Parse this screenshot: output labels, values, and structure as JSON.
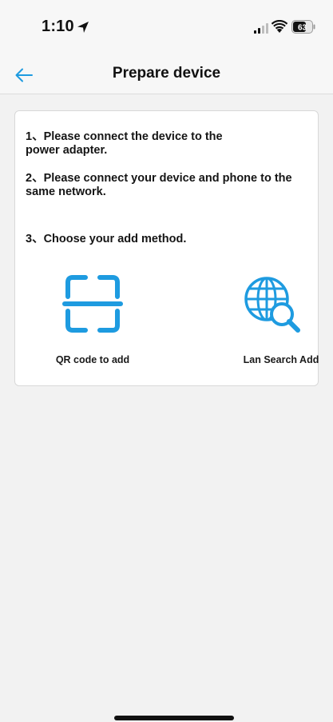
{
  "status_bar": {
    "time": "1:10",
    "battery": "63"
  },
  "nav": {
    "title": "Prepare device"
  },
  "steps": {
    "step1": "1、Please connect the device to the\npower adapter.",
    "step2": "2、Please connect your device and phone to the\nsame network.",
    "step3": "3、Choose your add method."
  },
  "methods": {
    "qr_label": "QR code to add",
    "lan_label": "Lan Search Add"
  },
  "colors": {
    "accent": "#1e9be0",
    "background": "#f2f2f2",
    "card": "#ffffff"
  },
  "icons": {
    "back": "back-arrow-icon",
    "qr": "qr-scan-icon",
    "lan": "globe-search-icon"
  }
}
